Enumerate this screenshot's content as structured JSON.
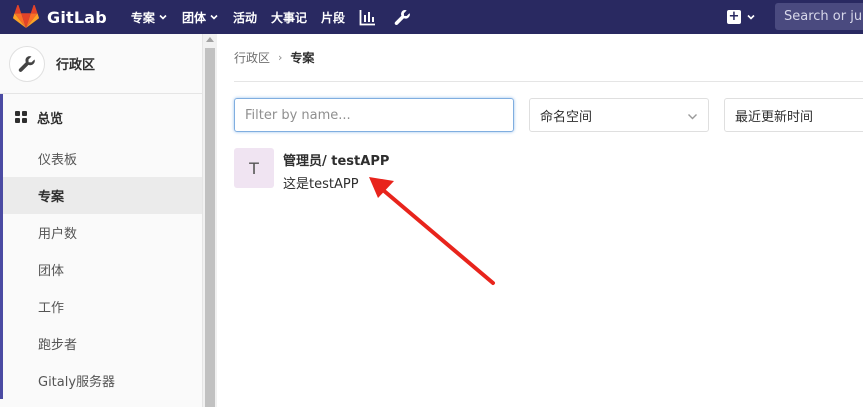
{
  "topbar": {
    "brand": "GitLab",
    "nav": [
      {
        "label": "专案",
        "dropdown": true
      },
      {
        "label": "团体",
        "dropdown": true
      },
      {
        "label": "活动",
        "dropdown": false
      },
      {
        "label": "大事记",
        "dropdown": false
      },
      {
        "label": "片段",
        "dropdown": false
      }
    ],
    "icons": [
      "bar-chart-icon",
      "wrench-icon"
    ],
    "new_icon": "plus-square-icon",
    "search_placeholder": "Search or jump to..."
  },
  "sidebar": {
    "context_title": "行政区",
    "context_icon": "wrench-icon",
    "section": {
      "label": "总览",
      "icon": "grid-icon"
    },
    "items": [
      {
        "label": "仪表板",
        "active": false
      },
      {
        "label": "专案",
        "active": true
      },
      {
        "label": "用户数",
        "active": false
      },
      {
        "label": "团体",
        "active": false
      },
      {
        "label": "工作",
        "active": false
      },
      {
        "label": "跑步者",
        "active": false
      },
      {
        "label": "Gitaly服务器",
        "active": false
      }
    ]
  },
  "main": {
    "breadcrumb": {
      "parent": "行政区",
      "current": "专案"
    },
    "filter_placeholder": "Filter by name...",
    "namespace_select": "命名空间",
    "sort_select": "最近更新时间",
    "project": {
      "avatar_letter": "T",
      "name": "管理员/ testAPP",
      "description": "这是testAPP"
    }
  },
  "colors": {
    "topbar": "#292961",
    "sidebar_accent": "#4b4ba3",
    "annotation_arrow": "#e8241c"
  }
}
